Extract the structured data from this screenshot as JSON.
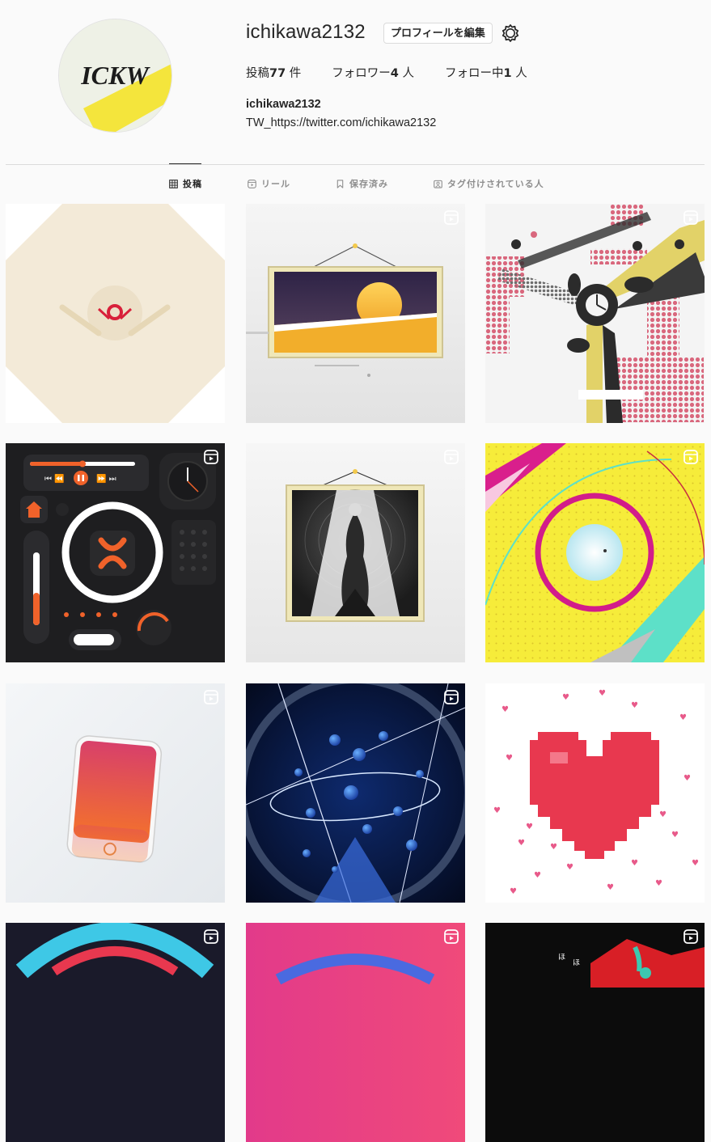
{
  "profile": {
    "username": "ichikawa2132",
    "edit_label": "プロフィールを編集",
    "avatar_text": "ICKW",
    "stats": {
      "posts_label": "投稿",
      "posts_count": "77",
      "posts_unit": " 件",
      "followers_label": "フォロワー",
      "followers_count": "4",
      "followers_unit": " 人",
      "following_label": "フォロー中",
      "following_count": "1",
      "following_unit": " 人"
    },
    "fullname": "ichikawa2132",
    "bio": "TW_https://twitter.com/ichikawa2132"
  },
  "tabs": [
    {
      "label": "投稿",
      "icon": "grid-icon",
      "active": true
    },
    {
      "label": "リール",
      "icon": "reels-icon",
      "active": false
    },
    {
      "label": "保存済み",
      "icon": "bookmark-icon",
      "active": false
    },
    {
      "label": "タグ付けされている人",
      "icon": "tagged-icon",
      "active": false
    }
  ],
  "posts": [
    {
      "art": "octagon-emblem",
      "reel": false
    },
    {
      "art": "framed-sunset",
      "reel": true
    },
    {
      "art": "clock-dots",
      "reel": true
    },
    {
      "art": "dark-control-panel",
      "reel": true
    },
    {
      "art": "framed-figure",
      "reel": true
    },
    {
      "art": "yellow-ring",
      "reel": true
    },
    {
      "art": "phone-gradient",
      "reel": true
    },
    {
      "art": "blue-orbit",
      "reel": true
    },
    {
      "art": "pixel-heart",
      "reel": false
    },
    {
      "art": "partial-dark-arc",
      "reel": true
    },
    {
      "art": "partial-pink",
      "reel": true
    },
    {
      "art": "partial-red-black",
      "reel": true
    }
  ],
  "colors": {
    "accent_orange": "#f0622a",
    "heart_red": "#e8384f",
    "ring_magenta": "#d21c8a",
    "avatar_yellow": "#f4e53c"
  }
}
